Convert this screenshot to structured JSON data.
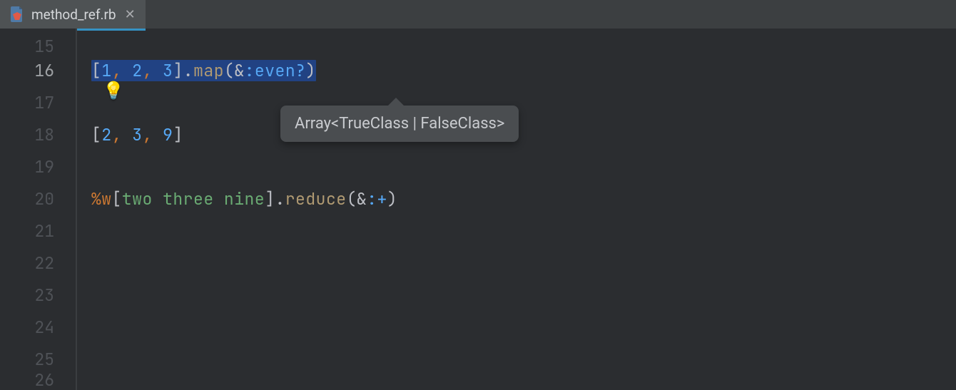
{
  "tab": {
    "filename": "method_ref.rb"
  },
  "gutter": {
    "lines": [
      "15",
      "16",
      "17",
      "18",
      "19",
      "20",
      "21",
      "22",
      "23",
      "24",
      "25",
      "26"
    ],
    "current": "16"
  },
  "code": {
    "l16": {
      "n1": "1",
      "c1": ", ",
      "n2": "2",
      "c2": ", ",
      "n3": "3",
      "br_open": "[",
      "br_close": "]",
      "dot": ".",
      "call": "map",
      "po": "(",
      "amp": "&",
      "sym": ":even?",
      "pc": ")"
    },
    "l18": {
      "br_open": "[",
      "n1": "2",
      "c1": ", ",
      "n2": "3",
      "c2": ", ",
      "n3": "9",
      "br_close": "]"
    },
    "l20": {
      "pct": "%w",
      "br_open": "[",
      "w": "two three nine",
      "br_close": "]",
      "dot": ".",
      "call": "reduce",
      "po": "(",
      "amp": "&",
      "sym": ":+",
      "pc": ")"
    }
  },
  "tooltip": {
    "text": "Array<TrueClass | FalseClass>"
  }
}
